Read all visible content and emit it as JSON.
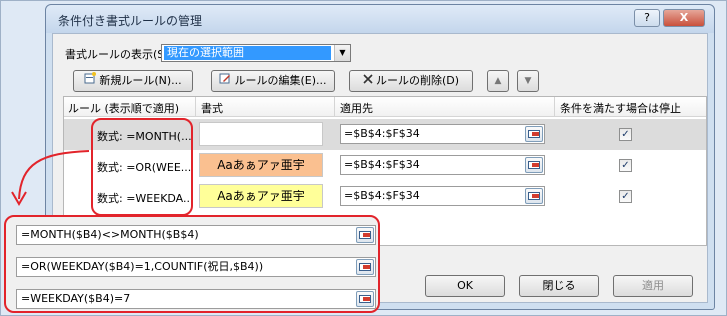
{
  "dialog": {
    "title": "条件付き書式ルールの管理",
    "help_button": "?",
    "close_button": "X"
  },
  "show_rules": {
    "label": "書式ルールの表示(S):",
    "selected": "現在の選択範囲",
    "arrow": "▼"
  },
  "toolbar": {
    "new_rule": "新規ルール(N)...",
    "edit_rule": "ルールの編集(E)...",
    "delete_rule": "ルールの削除(D)",
    "move_up": "▲",
    "move_down": "▼"
  },
  "columns": {
    "rule": "ルール (表示順で適用)",
    "format": "書式",
    "applies_to": "適用先",
    "stop_if_true": "条件を満たす場合は停止"
  },
  "rules": [
    {
      "rule": "数式: =MONTH(...",
      "format_preview": "",
      "preview_bg": "#ffffff",
      "applies_to": "=$B$4:$F$34",
      "stop_if_true": true,
      "checkmark": "✓"
    },
    {
      "rule": "数式: =OR(WEE...",
      "format_preview": "Aaあぁアァ亜宇",
      "preview_bg": "#fac090",
      "applies_to": "=$B$4:$F$34",
      "stop_if_true": true,
      "checkmark": "✓"
    },
    {
      "rule": "数式: =WEEKDA...",
      "format_preview": "Aaあぁアァ亜宇",
      "preview_bg": "#ffff99",
      "applies_to": "=$B$4:$F$34",
      "stop_if_true": true,
      "checkmark": "✓"
    }
  ],
  "footer": {
    "ok": "OK",
    "close": "閉じる",
    "apply": "適用"
  },
  "expanded_formulas": [
    "=MONTH($B4)<>MONTH($B$4)",
    "=OR(WEEKDAY($B4)=1,COUNTIF(祝日,$B4))",
    "=WEEKDAY($B4)=7"
  ],
  "colors": {
    "accent": "#3399ff",
    "callout": "#e2242b"
  }
}
